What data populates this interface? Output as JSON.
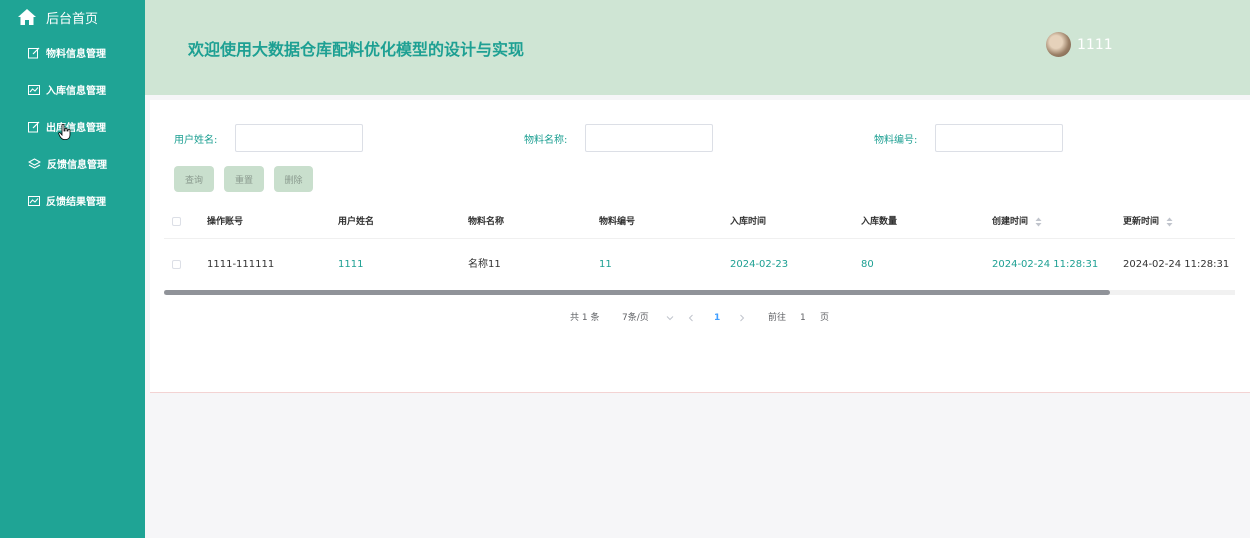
{
  "sidebar": {
    "home_label": "后台首页",
    "items": [
      {
        "label": "物料信息管理",
        "icon": "edit-icon"
      },
      {
        "label": "入库信息管理",
        "icon": "chart-icon"
      },
      {
        "label": "出库信息管理",
        "icon": "edit-icon"
      },
      {
        "label": "反馈信息管理",
        "icon": "layers-icon"
      },
      {
        "label": "反馈结果管理",
        "icon": "chart-icon"
      }
    ]
  },
  "header": {
    "title": "欢迎使用大数据仓库配料优化模型的设计与实现",
    "user_name": "1111"
  },
  "filters": {
    "user_name_label": "用户姓名:",
    "material_name_label": "物料名称:",
    "material_code_label": "物料编号:",
    "user_name_value": "",
    "material_name_value": "",
    "material_code_value": ""
  },
  "buttons": {
    "query": "查询",
    "reset": "重置",
    "delete": "删除"
  },
  "table": {
    "columns": [
      "操作账号",
      "用户姓名",
      "物料名称",
      "物料编号",
      "入库时间",
      "入库数量",
      "创建时间",
      "更新时间"
    ],
    "rows": [
      [
        "1111-111111",
        "1111",
        "名称11",
        "11",
        "2024-02-23",
        "80",
        "2024-02-24 11:28:31",
        "2024-02-24 11:28:31"
      ]
    ]
  },
  "pagination": {
    "total": "共 1 条",
    "page_size": "7条/页",
    "current_page": "1",
    "goto_label": "前往",
    "goto_value": "1",
    "page_suffix": "页"
  },
  "colors": {
    "sidebar": "#1fa495",
    "header": "#cfe5d4",
    "accent": "#1ea093",
    "button": "#c9dfcd"
  }
}
